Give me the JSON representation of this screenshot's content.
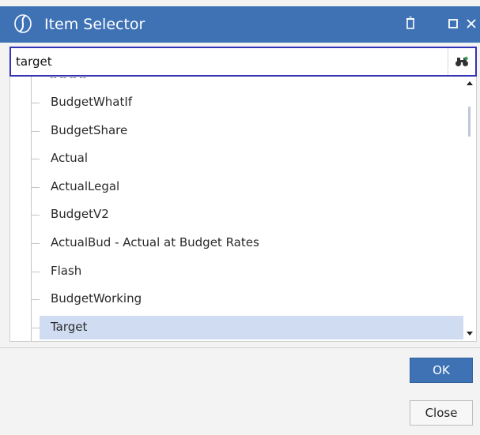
{
  "window": {
    "title": "Item Selector",
    "accent_color": "#3e72b5",
    "icons": {
      "app_logo": "onestream-logo-icon",
      "pin": "pin-icon",
      "restore": "restore-icon",
      "close": "close-icon"
    }
  },
  "search": {
    "value": "target",
    "icon": "binoculars-icon"
  },
  "tree": {
    "items": [
      {
        "label": "BudgetWhatIf",
        "selected": false
      },
      {
        "label": "BudgetShare",
        "selected": false
      },
      {
        "label": "Actual",
        "selected": false
      },
      {
        "label": "ActualLegal",
        "selected": false
      },
      {
        "label": "BudgetV2",
        "selected": false
      },
      {
        "label": "ActualBud - Actual at Budget Rates",
        "selected": false
      },
      {
        "label": "Flash",
        "selected": false
      },
      {
        "label": "BudgetWorking",
        "selected": false
      },
      {
        "label": "Target",
        "selected": true
      }
    ],
    "selected_color": "#d0dcf2"
  },
  "buttons": {
    "ok_label": "OK",
    "close_label": "Close"
  }
}
